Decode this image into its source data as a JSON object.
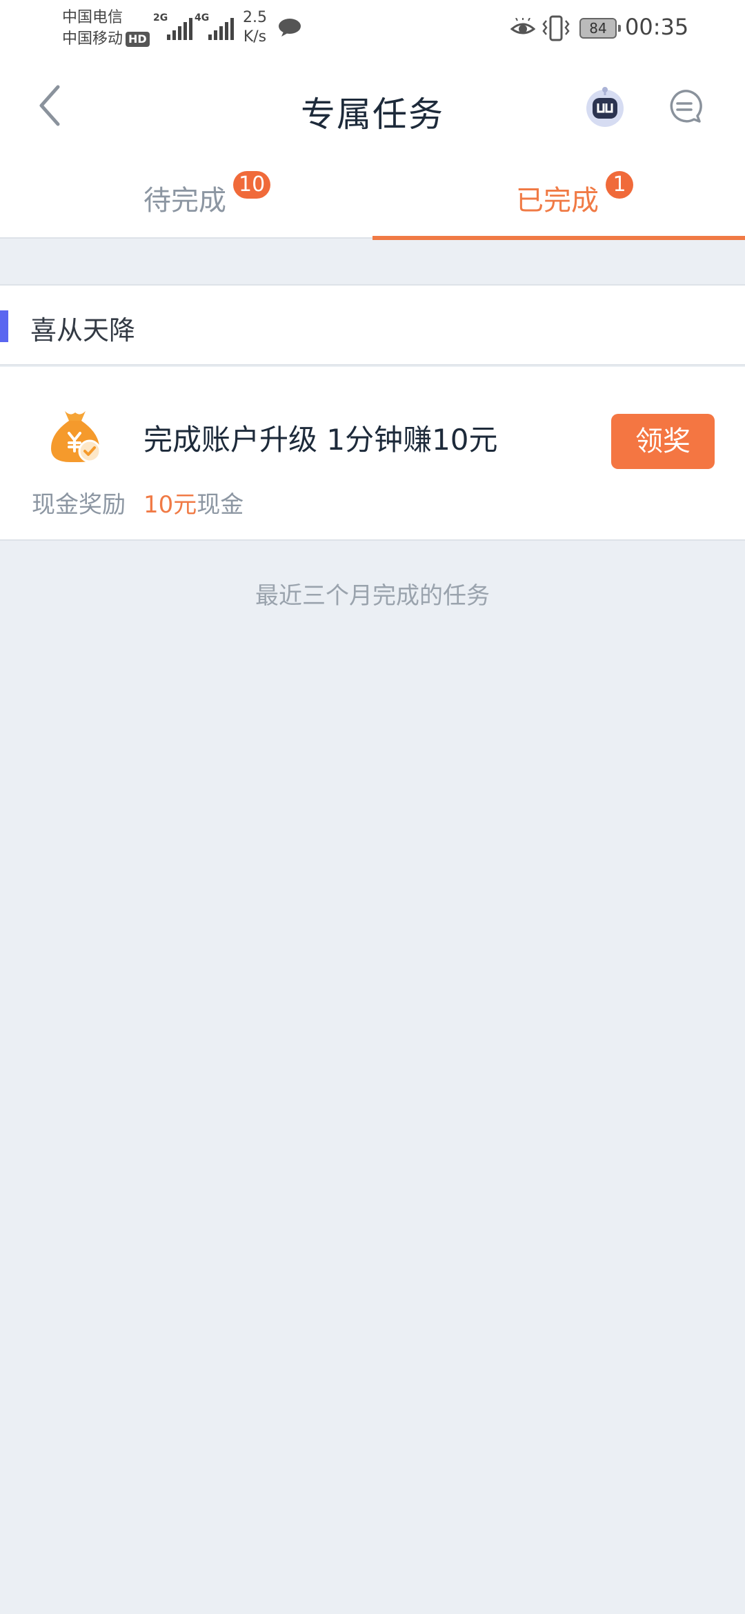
{
  "status_bar": {
    "carrier_1": "中国电信",
    "carrier_2": "中国移动",
    "hd_badge": "HD",
    "signal_1_type": "2G",
    "signal_2_type": "4G",
    "net_speed_value": "2.5",
    "net_speed_unit": "K/s",
    "battery_percent": "84",
    "time": "00:35"
  },
  "header": {
    "title": "专属任务"
  },
  "tabs": [
    {
      "label": "待完成",
      "badge": "10"
    },
    {
      "label": "已完成",
      "badge": "1"
    }
  ],
  "active_tab_index": 1,
  "section": {
    "title": "喜从天降"
  },
  "task": {
    "title": "完成账户升级 1分钟赚10元",
    "reward_type": "现金奖励",
    "reward_amount": "10元",
    "reward_unit": "现金",
    "claim_label": "领奖"
  },
  "footer_note": "最近三个月完成的任务",
  "colors": {
    "accent": "#f07a45",
    "section_accent": "#5a66f0",
    "background": "#ebeff4"
  }
}
